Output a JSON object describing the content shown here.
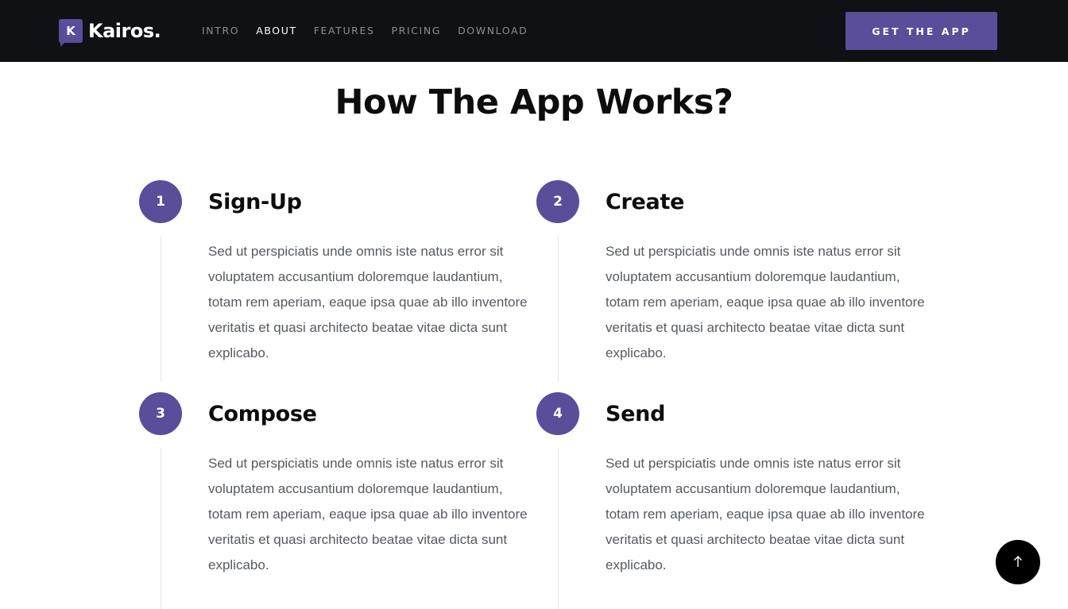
{
  "header": {
    "logo_mark": "K",
    "logo_text": "Kairos.",
    "nav": [
      {
        "label": "INTRO"
      },
      {
        "label": "ABOUT",
        "active": true
      },
      {
        "label": "FEATURES"
      },
      {
        "label": "PRICING"
      },
      {
        "label": "DOWNLOAD"
      }
    ],
    "cta_label": "GET THE APP"
  },
  "section": {
    "title": "How The App Works?",
    "steps": [
      {
        "number": "1",
        "title": "Sign-Up",
        "text": "Sed ut perspiciatis unde omnis iste natus error sit voluptatem accusantium doloremque laudantium, totam rem aperiam, eaque ipsa quae ab illo inventore veritatis et quasi architecto beatae vitae dicta sunt explicabo."
      },
      {
        "number": "2",
        "title": "Create",
        "text": "Sed ut perspiciatis unde omnis iste natus error sit voluptatem accusantium doloremque laudantium, totam rem aperiam, eaque ipsa quae ab illo inventore veritatis et quasi architecto beatae vitae dicta sunt explicabo."
      },
      {
        "number": "3",
        "title": "Compose",
        "text": "Sed ut perspiciatis unde omnis iste natus error sit voluptatem accusantium doloremque laudantium, totam rem aperiam, eaque ipsa quae ab illo inventore veritatis et quasi architecto beatae vitae dicta sunt explicabo."
      },
      {
        "number": "4",
        "title": "Send",
        "text": "Sed ut perspiciatis unde omnis iste natus error sit voluptatem accusantium doloremque laudantium, totam rem aperiam, eaque ipsa quae ab illo inventore veritatis et quasi architecto beatae vitae dicta sunt explicabo."
      }
    ]
  },
  "scroll_top_icon": "arrow-up-icon",
  "colors": {
    "header_bg": "#0f1114",
    "accent": "#5a4d9a",
    "nav_inactive": "#8a8d93",
    "nav_active": "#ffffff",
    "body_text": "#555a60",
    "heading": "#0d0d0d"
  }
}
